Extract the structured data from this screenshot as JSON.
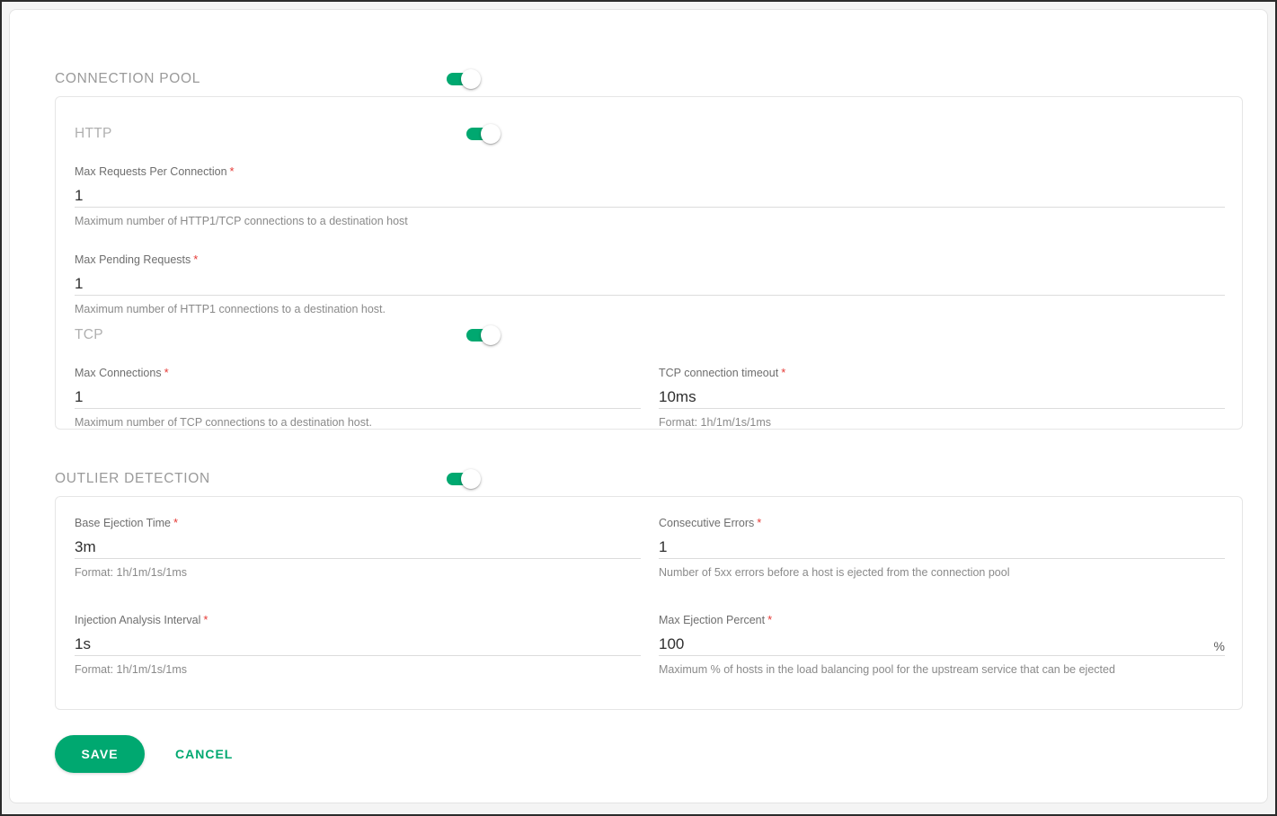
{
  "theme": {
    "accent": "#00a870",
    "required_marker_color": "#e53935",
    "section_title_color": "#9a9a9a",
    "value_text_color": "#2f2f2f"
  },
  "connection_pool": {
    "title": "CONNECTION POOL",
    "enabled": true,
    "http": {
      "title": "HTTP",
      "enabled": true,
      "fields": [
        {
          "label": "Max Requests Per Connection",
          "required_marker": "*",
          "value": "1",
          "hint": "Maximum number of HTTP1/TCP connections to a destination host"
        },
        {
          "label": "Max Pending Requests",
          "required_marker": "*",
          "value": "1",
          "hint": "Maximum number of HTTP1 connections to a destination host."
        }
      ]
    },
    "tcp": {
      "title": "TCP",
      "enabled": true,
      "fields": [
        {
          "label": "Max Connections",
          "required_marker": "*",
          "value": "1",
          "hint": "Maximum number of TCP connections to a destination host."
        },
        {
          "label": "TCP connection timeout",
          "required_marker": "*",
          "value": "10ms",
          "hint": "Format: 1h/1m/1s/1ms"
        }
      ]
    }
  },
  "outlier_detection": {
    "title": "OUTLIER DETECTION",
    "enabled": true,
    "fields": [
      {
        "label": "Base Ejection Time",
        "required_marker": "*",
        "value": "3m",
        "hint": "Format: 1h/1m/1s/1ms"
      },
      {
        "label": "Consecutive Errors",
        "required_marker": "*",
        "value": "1",
        "hint": "Number of 5xx errors before a host is ejected from the connection pool"
      },
      {
        "label": "Injection Analysis Interval",
        "required_marker": "*",
        "value": "1s",
        "hint": "Format: 1h/1m/1s/1ms"
      },
      {
        "label": "Max Ejection Percent",
        "required_marker": "*",
        "value": "100",
        "suffix": "%",
        "hint": "Maximum % of hosts in the load balancing pool for the upstream service that can be ejected"
      }
    ]
  },
  "actions": {
    "save_label": "SAVE",
    "cancel_label": "CANCEL"
  }
}
